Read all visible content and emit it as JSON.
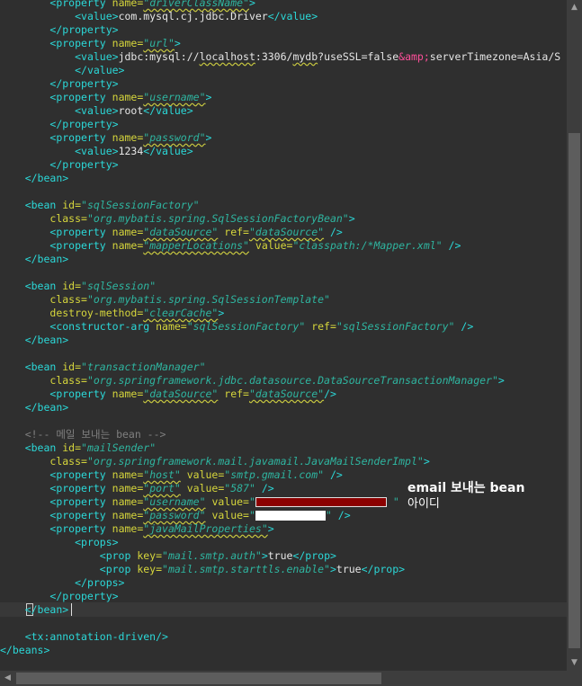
{
  "annotation": {
    "title": "email 보내는 bean",
    "subtitle": "아이디"
  },
  "icons": {
    "scroll_up": "arrow-up-icon",
    "scroll_down": "arrow-down-icon",
    "scroll_left": "arrow-left-icon"
  },
  "colors": {
    "background": "#2f2f2f",
    "tag": "#2bd8d8",
    "attribute": "#d6d63c",
    "string": "#2fb5a0",
    "entity": "#ff4f9a",
    "comment": "#7f7f7f",
    "redaction_red": "#8b0000"
  },
  "code": [
    [
      [
        "",
        "        "
      ],
      [
        "tag",
        "<property "
      ],
      [
        "attr",
        "name="
      ],
      [
        "str",
        "\"driverClassName\""
      ],
      [
        "tag",
        ">"
      ]
    ],
    [
      [
        "",
        "            "
      ],
      [
        "tag",
        "<value>"
      ],
      [
        "txt",
        "com.mysql.cj.jdbc.Driver"
      ],
      [
        "tag",
        "</value>"
      ]
    ],
    [
      [
        "",
        "        "
      ],
      [
        "tag",
        "</property>"
      ]
    ],
    [
      [
        "",
        "        "
      ],
      [
        "tag",
        "<property "
      ],
      [
        "attr",
        "name="
      ],
      [
        "str",
        "\"url\""
      ],
      [
        "tag",
        ">"
      ]
    ],
    [
      [
        "",
        "            "
      ],
      [
        "tag",
        "<value>"
      ],
      [
        "txt",
        "jdbc:mysql://localhost:3306/mydb?useSSL=false"
      ],
      [
        "ent",
        "&amp;"
      ],
      [
        "txt",
        "serverTimezone=Asia/S"
      ]
    ],
    [
      [
        "",
        "            "
      ],
      [
        "tag",
        "</value>"
      ]
    ],
    [
      [
        "",
        "        "
      ],
      [
        "tag",
        "</property>"
      ]
    ],
    [
      [
        "",
        "        "
      ],
      [
        "tag",
        "<property "
      ],
      [
        "attr",
        "name="
      ],
      [
        "str",
        "\"username\""
      ],
      [
        "tag",
        ">"
      ]
    ],
    [
      [
        "",
        "            "
      ],
      [
        "tag",
        "<value>"
      ],
      [
        "txt",
        "root"
      ],
      [
        "tag",
        "</value>"
      ]
    ],
    [
      [
        "",
        "        "
      ],
      [
        "tag",
        "</property>"
      ]
    ],
    [
      [
        "",
        "        "
      ],
      [
        "tag",
        "<property "
      ],
      [
        "attr",
        "name="
      ],
      [
        "str",
        "\"password\""
      ],
      [
        "tag",
        ">"
      ]
    ],
    [
      [
        "",
        "            "
      ],
      [
        "tag",
        "<value>"
      ],
      [
        "txt",
        "1234"
      ],
      [
        "tag",
        "</value>"
      ]
    ],
    [
      [
        "",
        "        "
      ],
      [
        "tag",
        "</property>"
      ]
    ],
    [
      [
        "",
        "    "
      ],
      [
        "tag",
        "</bean>"
      ]
    ],
    [],
    [
      [
        "",
        "    "
      ],
      [
        "tag",
        "<bean "
      ],
      [
        "attr",
        "id="
      ],
      [
        "str",
        "\"sqlSessionFactory\""
      ]
    ],
    [
      [
        "",
        "        "
      ],
      [
        "attr",
        "class="
      ],
      [
        "str",
        "\"org.mybatis.spring.SqlSessionFactoryBean\""
      ],
      [
        "tag",
        ">"
      ]
    ],
    [
      [
        "",
        "        "
      ],
      [
        "tag",
        "<property "
      ],
      [
        "attr",
        "name="
      ],
      [
        "str",
        "\"dataSource\""
      ],
      [
        "attr",
        " ref="
      ],
      [
        "str",
        "\"dataSource\""
      ],
      [
        "tag",
        " />"
      ]
    ],
    [
      [
        "",
        "        "
      ],
      [
        "tag",
        "<property "
      ],
      [
        "attr",
        "name="
      ],
      [
        "str",
        "\"mapperLocations\""
      ],
      [
        "attr",
        " value="
      ],
      [
        "str",
        "\"classpath:/*Mapper.xml\""
      ],
      [
        "tag",
        " />"
      ]
    ],
    [
      [
        "",
        "    "
      ],
      [
        "tag",
        "</bean>"
      ]
    ],
    [],
    [
      [
        "",
        "    "
      ],
      [
        "tag",
        "<bean "
      ],
      [
        "attr",
        "id="
      ],
      [
        "str",
        "\"sqlSession\""
      ]
    ],
    [
      [
        "",
        "        "
      ],
      [
        "attr",
        "class="
      ],
      [
        "str",
        "\"org.mybatis.spring.SqlSessionTemplate\""
      ]
    ],
    [
      [
        "",
        "        "
      ],
      [
        "attr",
        "destroy-method="
      ],
      [
        "str",
        "\"clearCache\""
      ],
      [
        "tag",
        ">"
      ]
    ],
    [
      [
        "",
        "        "
      ],
      [
        "tag",
        "<constructor-arg "
      ],
      [
        "attr",
        "name="
      ],
      [
        "str",
        "\"sqlSessionFactory\""
      ],
      [
        "attr",
        " ref="
      ],
      [
        "str",
        "\"sqlSessionFactory\""
      ],
      [
        "tag",
        " />"
      ]
    ],
    [
      [
        "",
        "    "
      ],
      [
        "tag",
        "</bean>"
      ]
    ],
    [],
    [
      [
        "",
        "    "
      ],
      [
        "tag",
        "<bean "
      ],
      [
        "attr",
        "id="
      ],
      [
        "str",
        "\"transactionManager\""
      ]
    ],
    [
      [
        "",
        "        "
      ],
      [
        "attr",
        "class="
      ],
      [
        "str",
        "\"org.springframework.jdbc.datasource.DataSourceTransactionManager\""
      ],
      [
        "tag",
        ">"
      ]
    ],
    [
      [
        "",
        "        "
      ],
      [
        "tag",
        "<property "
      ],
      [
        "attr",
        "name="
      ],
      [
        "str",
        "\"dataSource\""
      ],
      [
        "attr",
        " ref="
      ],
      [
        "str",
        "\"dataSource\""
      ],
      [
        "tag",
        "/>"
      ]
    ],
    [
      [
        "",
        "    "
      ],
      [
        "tag",
        "</bean>"
      ]
    ],
    [],
    [
      [
        "",
        "    "
      ],
      [
        "cm",
        "<!-- 메일 보내는 bean -->"
      ]
    ],
    [
      [
        "",
        "    "
      ],
      [
        "tag",
        "<bean "
      ],
      [
        "attr",
        "id="
      ],
      [
        "str",
        "\"mailSender\""
      ]
    ],
    [
      [
        "",
        "        "
      ],
      [
        "attr",
        "class="
      ],
      [
        "str",
        "\"org.springframework.mail.javamail.JavaMailSenderImpl\""
      ],
      [
        "tag",
        ">"
      ]
    ],
    [
      [
        "",
        "        "
      ],
      [
        "tag",
        "<property "
      ],
      [
        "attr",
        "name="
      ],
      [
        "str",
        "\"host\""
      ],
      [
        "attr",
        " value="
      ],
      [
        "str",
        "\"smtp.gmail.com\""
      ],
      [
        "tag",
        " />"
      ]
    ],
    [
      [
        "",
        "        "
      ],
      [
        "tag",
        "<property "
      ],
      [
        "attr",
        "name="
      ],
      [
        "str",
        "\"port\""
      ],
      [
        "attr",
        " value="
      ],
      [
        "str",
        "\"587\""
      ],
      [
        "tag",
        " />"
      ]
    ],
    [
      [
        "",
        "        "
      ],
      [
        "tag",
        "<property "
      ],
      [
        "attr",
        "name="
      ],
      [
        "str",
        "\"username\""
      ],
      [
        "attr",
        " value="
      ],
      [
        "str",
        "\""
      ],
      [
        "redact-red",
        ""
      ],
      [
        "str",
        " \""
      ]
    ],
    [
      [
        "",
        "        "
      ],
      [
        "tag",
        "<property "
      ],
      [
        "attr",
        "name="
      ],
      [
        "str",
        "\"password\""
      ],
      [
        "attr",
        " value="
      ],
      [
        "str",
        "\""
      ],
      [
        "redact-white",
        ""
      ],
      [
        "str",
        "\""
      ],
      [
        "tag",
        " />"
      ]
    ],
    [
      [
        "",
        "        "
      ],
      [
        "tag",
        "<property "
      ],
      [
        "attr",
        "name="
      ],
      [
        "str",
        "\"javaMailProperties\""
      ],
      [
        "tag",
        ">"
      ]
    ],
    [
      [
        "",
        "            "
      ],
      [
        "tag",
        "<props>"
      ]
    ],
    [
      [
        "",
        "                "
      ],
      [
        "tag",
        "<prop "
      ],
      [
        "attr",
        "key="
      ],
      [
        "str",
        "\"mail.smtp.auth\""
      ],
      [
        "tag",
        ">"
      ],
      [
        "txt",
        "true"
      ],
      [
        "tag",
        "</prop>"
      ]
    ],
    [
      [
        "",
        "                "
      ],
      [
        "tag",
        "<prop "
      ],
      [
        "attr",
        "key="
      ],
      [
        "str",
        "\"mail.smtp.starttls.enable\""
      ],
      [
        "tag",
        ">"
      ],
      [
        "txt",
        "true"
      ],
      [
        "tag",
        "</prop>"
      ]
    ],
    [
      [
        "",
        "            "
      ],
      [
        "tag",
        "</props>"
      ]
    ],
    [
      [
        "",
        "        "
      ],
      [
        "tag",
        "</property>"
      ]
    ],
    [
      [
        "",
        "    "
      ],
      [
        "tag",
        "</bean>"
      ]
    ],
    [],
    [
      [
        "",
        "    "
      ],
      [
        "tag",
        "<tx:annotation-driven/>"
      ]
    ],
    [
      [
        "tag",
        "</beans>"
      ]
    ]
  ]
}
